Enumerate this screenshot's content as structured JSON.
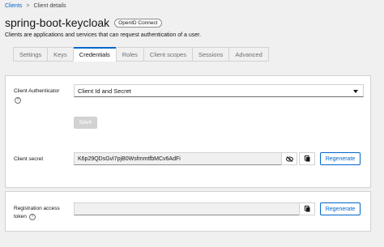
{
  "breadcrumb": {
    "clients": "Clients",
    "separator": ">",
    "current": "Client details"
  },
  "header": {
    "title": "spring-boot-keycloak",
    "badge": "OpenID Connect",
    "subtitle": "Clients are applications and services that can request authentication of a user."
  },
  "tabs": [
    "Settings",
    "Keys",
    "Credentials",
    "Roles",
    "Client scopes",
    "Sessions",
    "Advanced"
  ],
  "active_tab": "Credentials",
  "credentials": {
    "authenticator_label": "Client Authenticator",
    "authenticator_value": "Client Id and Secret",
    "save_label": "Save",
    "secret_label": "Client secret",
    "secret_value": "K6p29QDsGvl7pjB0WsfmmtfbMCv6AdFi",
    "regenerate_label": "Regenerate"
  },
  "registration": {
    "label_line1": "Registration access",
    "label_line2": "token",
    "token_value": "",
    "regenerate_label": "Regenerate"
  },
  "colors": {
    "accent": "#0066cc",
    "disabled": "#d2d2d2"
  }
}
